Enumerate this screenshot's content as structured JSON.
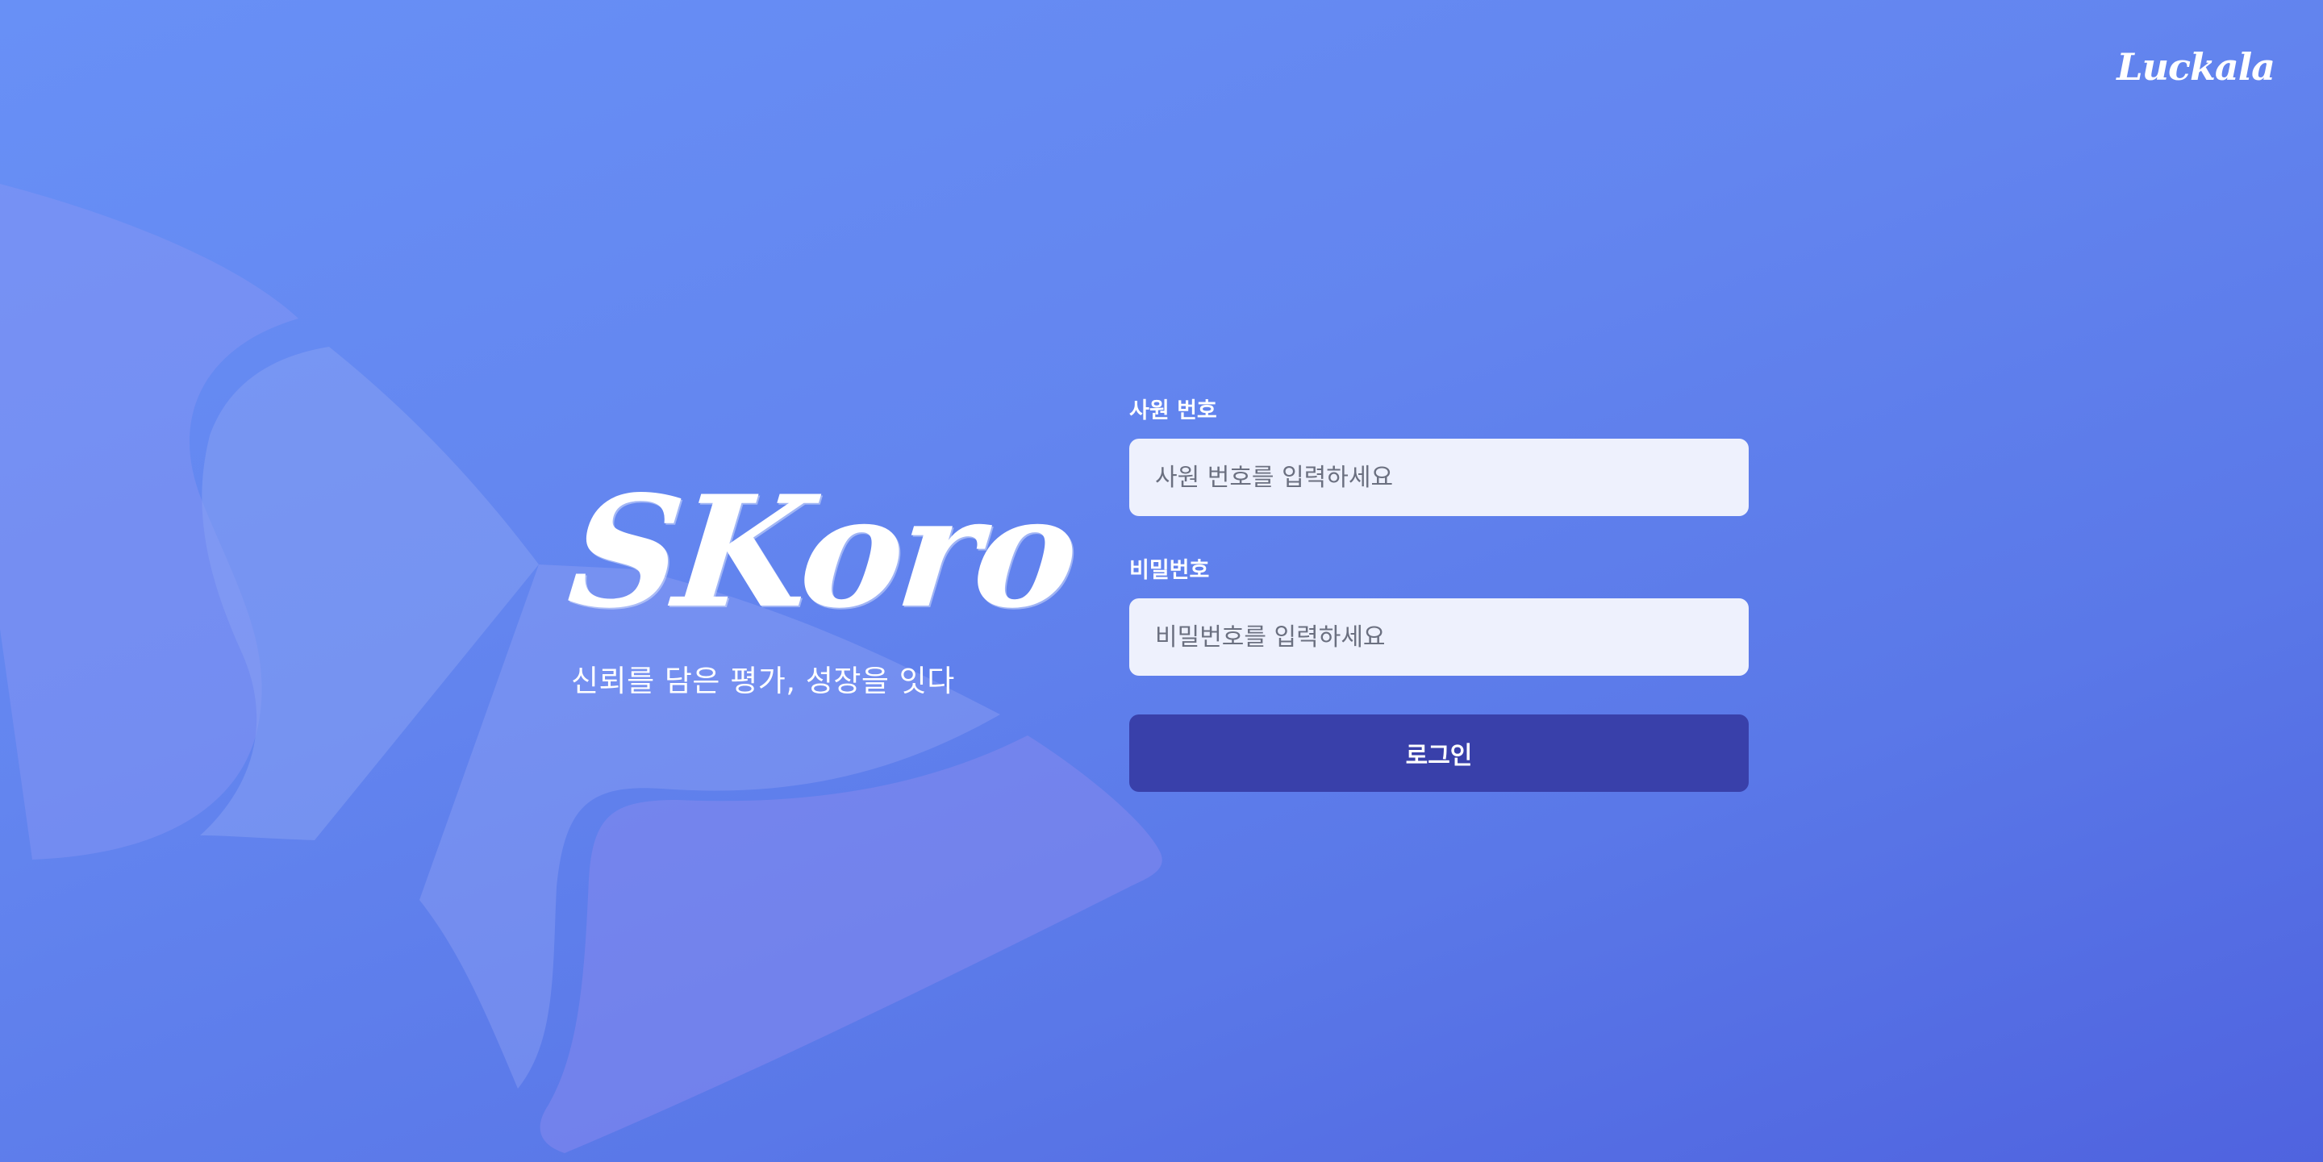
{
  "brand": {
    "logo_text": "Luckala"
  },
  "hero": {
    "title": "SKoro",
    "tagline": "신뢰를 담은 평가, 성장을 잇다"
  },
  "login": {
    "employee_id_label": "사원 번호",
    "employee_id_placeholder": "사원 번호를 입력하세요",
    "employee_id_value": "",
    "password_label": "비밀번호",
    "password_placeholder": "비밀번호를 입력하세요",
    "password_value": "",
    "submit_label": "로그인"
  },
  "colors": {
    "background_start": "#6890f6",
    "background_end": "#4f63df",
    "input_background": "#eef1fd",
    "button_background": "#3940aa",
    "text_light": "#ffffff"
  }
}
